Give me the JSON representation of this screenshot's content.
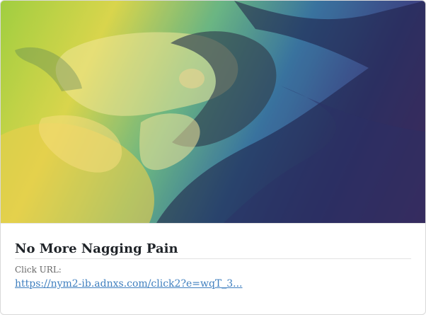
{
  "card": {
    "title": "No More Nagging Pain",
    "click_url_label": "Click URL:",
    "click_url": "https://nym2-ib.adnxs.com/click2?e=wqT_3..."
  },
  "hero": {
    "image_description_icon": "massage-therapy-image",
    "overlay_colors": [
      "#9acc33",
      "#d7d33f",
      "#5fb07a",
      "#2b6a98",
      "#30397d",
      "#5d2c6f"
    ]
  }
}
